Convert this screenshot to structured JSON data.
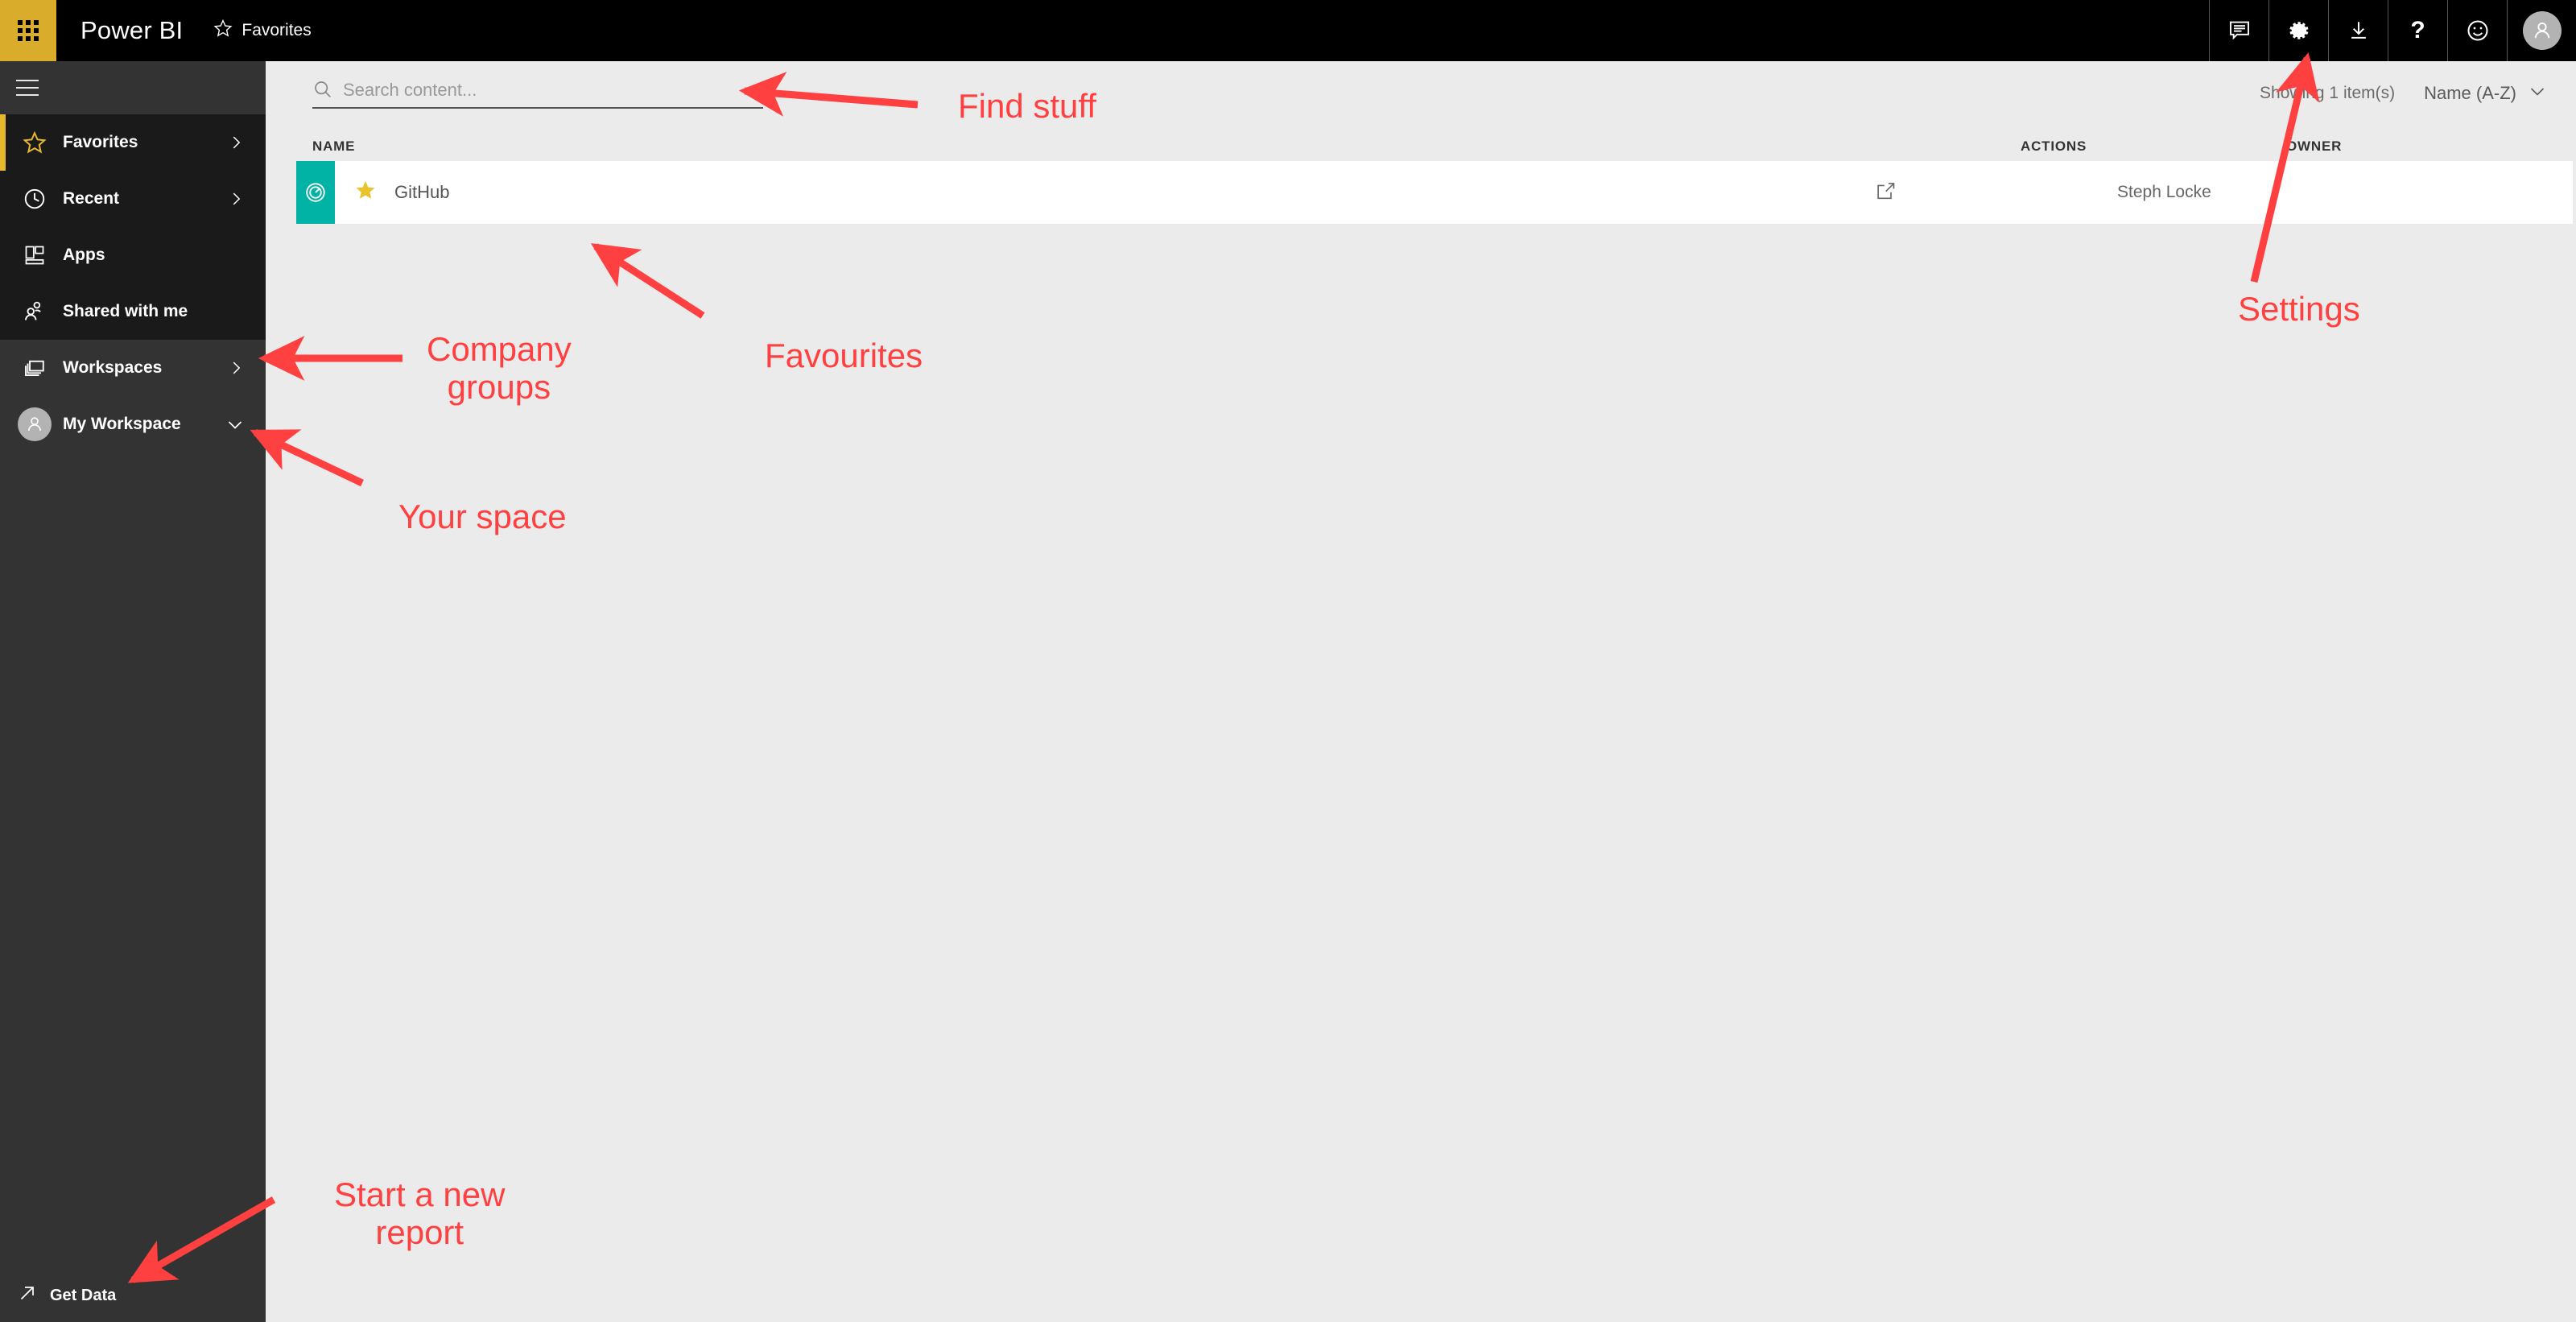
{
  "header": {
    "waffle_icon": "app-launcher-grid-icon",
    "brand": "Power BI",
    "breadcrumb_star_icon": "star-outline-icon",
    "breadcrumb": "Favorites",
    "actions": [
      {
        "name": "notifications",
        "icon": "announcement-icon",
        "glyph": ""
      },
      {
        "name": "settings",
        "icon": "gear-icon",
        "glyph": ""
      },
      {
        "name": "downloads",
        "icon": "download-icon",
        "glyph": ""
      },
      {
        "name": "help",
        "icon": "question-mark-icon",
        "glyph": "?"
      },
      {
        "name": "feedback",
        "icon": "smiley-icon",
        "glyph": ""
      },
      {
        "name": "account",
        "icon": "user-avatar-icon",
        "glyph": ""
      }
    ]
  },
  "sidebar": {
    "collapse_icon": "hamburger-icon",
    "items": [
      {
        "label": "Favorites",
        "icon": "star-outline-icon",
        "chevron": "chevron-right",
        "selected": true
      },
      {
        "label": "Recent",
        "icon": "clock-icon",
        "chevron": "chevron-right",
        "selected": false
      },
      {
        "label": "Apps",
        "icon": "apps-grid-icon",
        "chevron": "",
        "selected": false
      },
      {
        "label": "Shared with me",
        "icon": "people-icon",
        "chevron": "",
        "selected": false
      },
      {
        "label": "Workspaces",
        "icon": "workspaces-icon",
        "chevron": "chevron-right",
        "selected": false
      },
      {
        "label": "My Workspace",
        "icon": "user-avatar-icon",
        "chevron": "chevron-down",
        "selected": false
      }
    ],
    "get_data": {
      "label": "Get Data",
      "icon": "arrow-up-right-icon"
    },
    "accent_color": "#e8b92e"
  },
  "main": {
    "search": {
      "placeholder": "Search content...",
      "value": "",
      "icon": "search-icon"
    },
    "showing_count": "Showing 1 item(s)",
    "sort": {
      "value": "Name (A-Z)",
      "icon": "chevron-down-icon"
    },
    "columns": {
      "name": "NAME",
      "actions": "ACTIONS",
      "owner": "OWNER"
    },
    "rows": [
      {
        "tile_icon": "dashboard-gauge-icon",
        "tile_color": "#00b3a4",
        "favorite_icon": "star-filled-icon",
        "name": "GitHub",
        "action_icon": "share-icon",
        "owner": "Steph Locke"
      }
    ]
  },
  "annotations": {
    "color": "#ff4040",
    "items": [
      {
        "text": "Find stuff",
        "target": "search-input"
      },
      {
        "text": "Settings",
        "target": "gear-icon"
      },
      {
        "text": "Favourites",
        "target": "favorite-star-cell"
      },
      {
        "text": "Company\ngroups",
        "target": "sidebar-item-workspaces"
      },
      {
        "text": "Your space",
        "target": "sidebar-item-my-workspace"
      },
      {
        "text": "Start a new\nreport",
        "target": "get-data-button"
      }
    ]
  }
}
